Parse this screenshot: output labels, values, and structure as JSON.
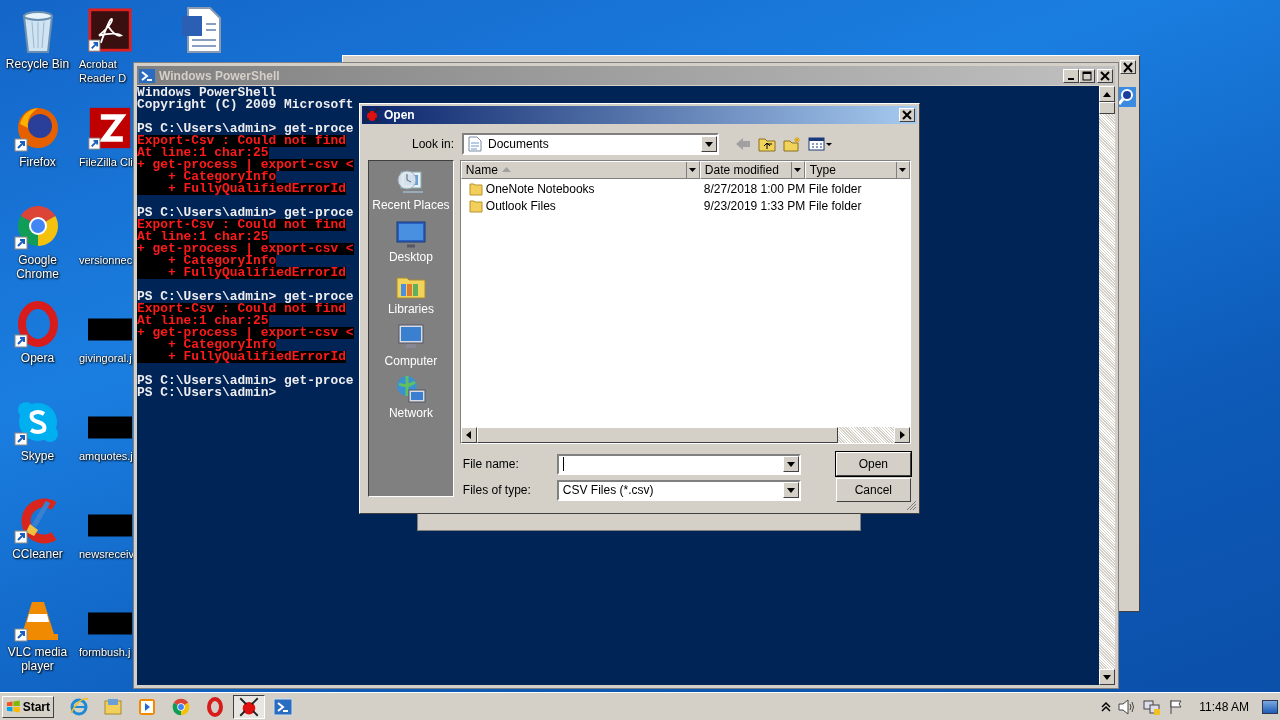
{
  "desktop": {
    "columns": [
      {
        "icons": [
          {
            "label": "Recycle Bin",
            "kind": "recycle"
          },
          {
            "label": "Firefox",
            "kind": "firefox"
          },
          {
            "label": "Google Chrome",
            "kind": "chrome"
          },
          {
            "label": "Opera",
            "kind": "opera"
          },
          {
            "label": "Skype",
            "kind": "skype"
          },
          {
            "label": "CCleaner",
            "kind": "ccleaner"
          },
          {
            "label": "VLC media player",
            "kind": "vlc"
          }
        ]
      },
      {
        "icons": [
          {
            "label": "Acrobat Reader D",
            "kind": "acrobat"
          },
          {
            "label": "FileZilla Cli",
            "kind": "filezilla"
          },
          {
            "label": "versionnec",
            "kind": "blank"
          },
          {
            "label": "givingoral.j",
            "kind": "redacted"
          },
          {
            "label": "amquotes.j",
            "kind": "redacted"
          },
          {
            "label": "newsreceiv",
            "kind": "redacted"
          },
          {
            "label": "formbush.j",
            "kind": "redacted"
          }
        ]
      },
      {
        "icons": [
          {
            "kind": "word"
          }
        ]
      }
    ]
  },
  "powershell": {
    "title": "Windows PowerShell",
    "lines": [
      {
        "kind": "plain",
        "text": "Windows PowerShell"
      },
      {
        "kind": "plain",
        "text": "Copyright (C) 2009 Microsoft"
      },
      {
        "kind": "blank"
      },
      {
        "kind": "plain",
        "text": "PS C:\\Users\\admin> get-proce"
      },
      {
        "kind": "error",
        "text": "Export-Csv : Could not find"
      },
      {
        "kind": "error",
        "text": "At line:1 char:25"
      },
      {
        "kind": "error",
        "text": "+ get-process | export-csv <"
      },
      {
        "kind": "error",
        "text": "    + CategoryInfo"
      },
      {
        "kind": "error",
        "text": "    + FullyQualifiedErrorId"
      },
      {
        "kind": "blank"
      },
      {
        "kind": "plain",
        "text": "PS C:\\Users\\admin> get-proce"
      },
      {
        "kind": "error",
        "text": "Export-Csv : Could not find"
      },
      {
        "kind": "error",
        "text": "At line:1 char:25"
      },
      {
        "kind": "error",
        "text": "+ get-process | export-csv <"
      },
      {
        "kind": "error",
        "text": "    + CategoryInfo"
      },
      {
        "kind": "error",
        "text": "    + FullyQualifiedErrorId"
      },
      {
        "kind": "blank"
      },
      {
        "kind": "plain",
        "text": "PS C:\\Users\\admin> get-proce"
      },
      {
        "kind": "error",
        "text": "Export-Csv : Could not find"
      },
      {
        "kind": "error",
        "text": "At line:1 char:25"
      },
      {
        "kind": "error",
        "text": "+ get-process | export-csv <"
      },
      {
        "kind": "error",
        "text": "    + CategoryInfo"
      },
      {
        "kind": "error",
        "text": "    + FullyQualifiedErrorId"
      },
      {
        "kind": "blank"
      },
      {
        "kind": "plain",
        "text": "PS C:\\Users\\admin> get-proce"
      },
      {
        "kind": "plain",
        "text": "PS C:\\Users\\admin>"
      }
    ]
  },
  "dialog": {
    "title": "Open",
    "look_in": {
      "label": "Look in:",
      "value": "Documents"
    },
    "places": [
      {
        "label": "Recent Places",
        "kind": "recent"
      },
      {
        "label": "Desktop",
        "kind": "desktop"
      },
      {
        "label": "Libraries",
        "kind": "libraries"
      },
      {
        "label": "Computer",
        "kind": "computer"
      },
      {
        "label": "Network",
        "kind": "network"
      }
    ],
    "columns": [
      {
        "label": "Name",
        "sorted": true
      },
      {
        "label": "Date modified",
        "sorted": false
      },
      {
        "label": "Type",
        "sorted": false
      }
    ],
    "files": [
      {
        "name": "OneNote Notebooks",
        "date": "8/27/2018 1:00 PM",
        "type": "File folder"
      },
      {
        "name": "Outlook Files",
        "date": "9/23/2019 1:33 PM",
        "type": "File folder"
      }
    ],
    "file_name": {
      "label": "File name:"
    },
    "file_type": {
      "label": "Files of type:",
      "value": "CSV Files (*.csv)"
    },
    "buttons": [
      {
        "label": "Open",
        "default": true
      },
      {
        "label": "Cancel",
        "default": false
      }
    ]
  },
  "taskbar": {
    "start": "Start",
    "apps": [
      {
        "kind": "ie",
        "active": false
      },
      {
        "kind": "explorer",
        "active": false
      },
      {
        "kind": "media",
        "active": false
      },
      {
        "kind": "chrome",
        "active": false
      },
      {
        "kind": "opera",
        "active": false
      },
      {
        "kind": "bug",
        "active": true
      },
      {
        "kind": "powershell",
        "active": false
      }
    ],
    "clock": "11:48 AM"
  }
}
